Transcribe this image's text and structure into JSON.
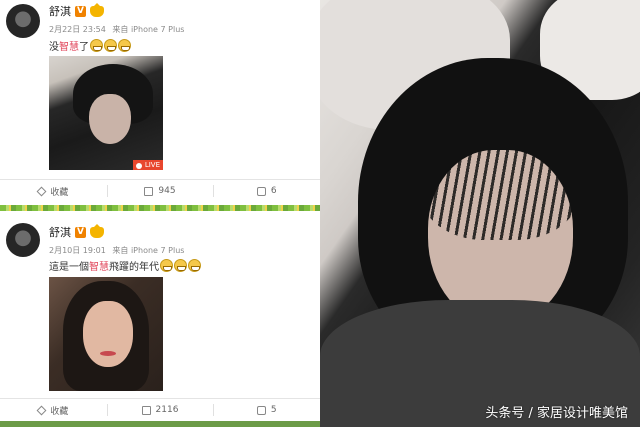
{
  "post1": {
    "username": "舒淇",
    "verified_badge": "V",
    "date": "2月22日 23:54",
    "source": "来自 iPhone 7 Plus",
    "text_before": "没",
    "text_highlight": "智慧",
    "text_after": "了",
    "emoji_count": 3,
    "live_label": "LIVE",
    "favorite_label": "收藏",
    "repost_count": "945",
    "comment_count": "6"
  },
  "post2": {
    "username": "舒淇",
    "verified_badge": "V",
    "date": "2月10日 19:01",
    "source": "来自 iPhone 7 Plus",
    "text_before": "這是一個",
    "text_highlight": "智慧",
    "text_after": "飛躍的年代",
    "emoji_count": 3,
    "favorite_label": "收藏",
    "repost_count": "2116",
    "comment_count": "5"
  },
  "watermark": "头条号 / 家居设计唯美馆",
  "colors": {
    "highlight": "#e0445a",
    "badge": "#f08200",
    "live": "#e8462d"
  }
}
